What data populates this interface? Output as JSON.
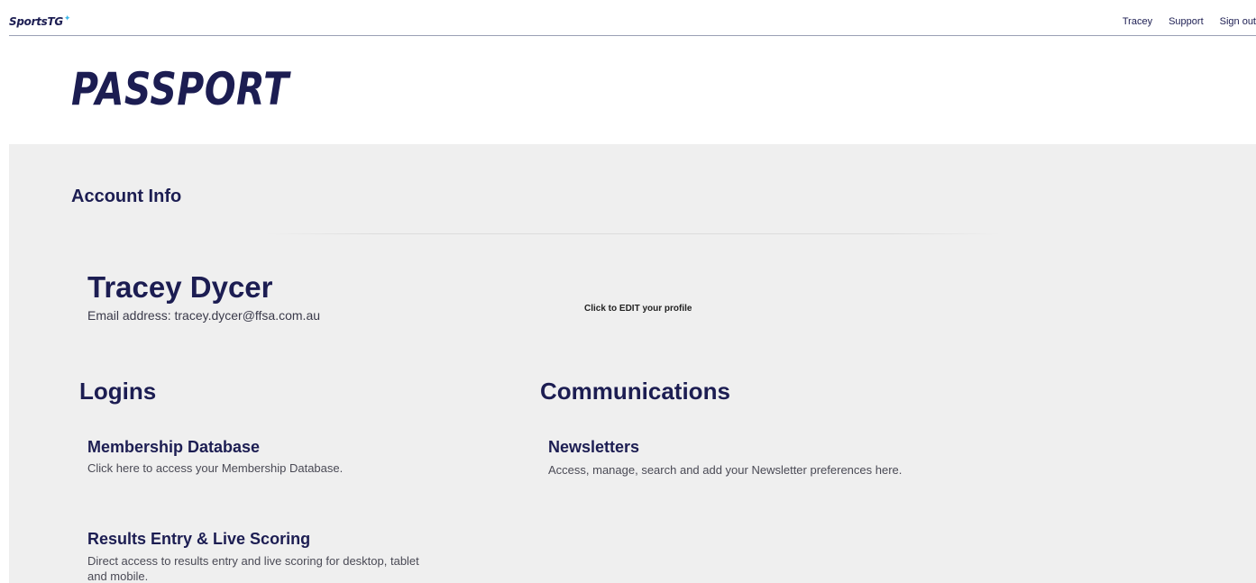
{
  "header": {
    "logo": "SportsTG",
    "logo_mark": "✦",
    "nav": {
      "user": "Tracey",
      "support": "Support",
      "sign_out": "Sign out"
    }
  },
  "page_title": "PASSPORT",
  "account": {
    "section_title": "Account Info",
    "name": "Tracey Dycer",
    "email_line": "Email address: tracey.dycer@ffsa.com.au",
    "edit_link": "Click to EDIT your profile"
  },
  "logins": {
    "title": "Logins",
    "items": [
      {
        "title": "Membership Database",
        "description": "Click here to access your Membership Database."
      },
      {
        "title": "Results Entry & Live Scoring",
        "description": "Direct access to results entry and live scoring for desktop, tablet and mobile."
      }
    ]
  },
  "communications": {
    "title": "Communications",
    "items": [
      {
        "title": "Newsletters",
        "description": "Access, manage, search and add your Newsletter preferences here."
      }
    ]
  },
  "colors": {
    "brand_navy": "#1c1d52",
    "accent_blue": "#3fb8e8",
    "panel_bg": "#efefef"
  }
}
